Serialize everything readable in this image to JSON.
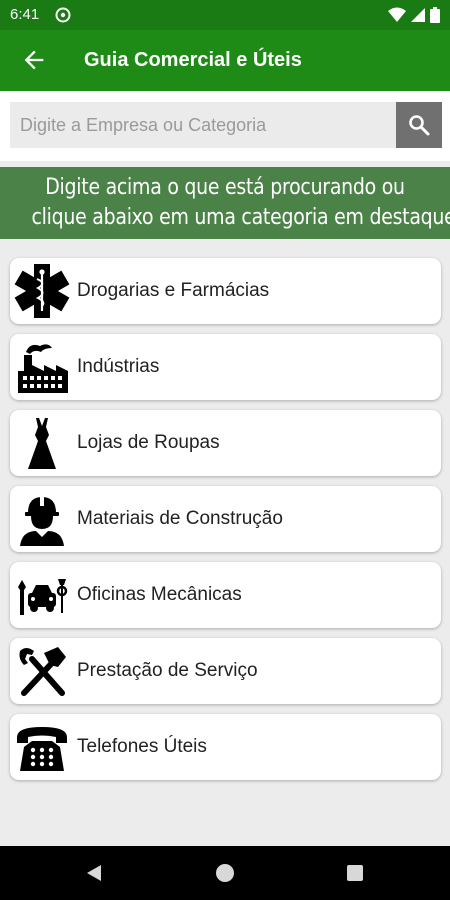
{
  "status_bar": {
    "time": "6:41",
    "icons": [
      "do-not-disturb-icon",
      "wifi-icon",
      "signal-icon",
      "battery-icon"
    ]
  },
  "app_bar": {
    "title": "Guia Comercial e Úteis",
    "background": "#1f8b17",
    "back_icon": "arrow-left-icon"
  },
  "search": {
    "placeholder": "Digite a Empresa ou Categoria",
    "value": "",
    "button_icon": "search-icon"
  },
  "banner": {
    "line1": "Digite acima o que está procurando ou",
    "line2": "clique abaixo em uma categoria em destaque",
    "background": "#4b8248"
  },
  "categories": [
    {
      "label": "Drogarias e Farmácias",
      "icon": "medical-star-icon"
    },
    {
      "label": "Indústrias",
      "icon": "factory-icon"
    },
    {
      "label": "Lojas de Roupas",
      "icon": "dress-icon"
    },
    {
      "label": "Materiais de Construção",
      "icon": "construction-worker-icon"
    },
    {
      "label": "Oficinas Mecânicas",
      "icon": "mechanic-icon"
    },
    {
      "label": "Prestação de Serviço",
      "icon": "hammer-wrench-icon"
    },
    {
      "label": "Telefones Úteis",
      "icon": "telephone-icon"
    }
  ],
  "nav_bar": {
    "buttons": [
      "back-triangle-icon",
      "home-circle-icon",
      "recents-square-icon"
    ]
  }
}
